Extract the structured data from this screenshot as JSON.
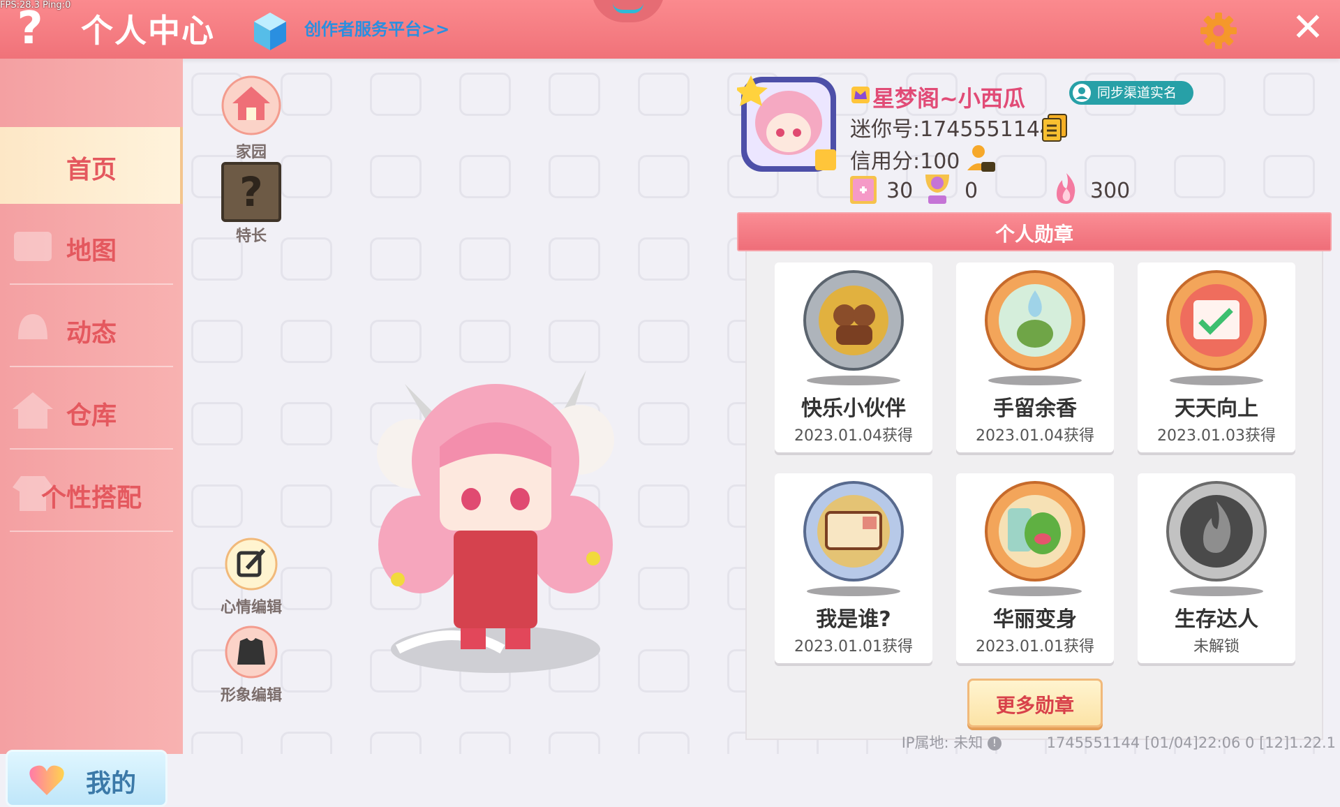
{
  "debug": {
    "fps": "FPS:28.3  Ping:0"
  },
  "header": {
    "help_icon": "question-mark-icon",
    "title": "个人中心",
    "creator_link": "创作者服务平台>>",
    "settings_icon": "gear-icon",
    "close_icon": "close-icon",
    "colors": {
      "bar": "#f07279",
      "link": "#2a8fe0"
    }
  },
  "sidebar": {
    "items": [
      {
        "label": "首页",
        "active": true
      },
      {
        "label": "地图",
        "active": false
      },
      {
        "label": "动态",
        "active": false
      },
      {
        "label": "仓库",
        "active": false
      },
      {
        "label": "个性搭配",
        "active": false
      }
    ],
    "mine_button": "我的"
  },
  "actions": {
    "home": "家园",
    "skill": "特长",
    "skill_icon_text": "?",
    "mood": "心情编辑",
    "appearance": "形象编辑"
  },
  "profile": {
    "nickname": "星梦阁~小西瓜",
    "sync_badge": "同步渠道实名",
    "mini_id": "迷你号:1745551144",
    "credit": "信用分:100",
    "stats": {
      "popularity": "30",
      "likes": "0",
      "heat": "300"
    }
  },
  "medals": {
    "title": "个人勋章",
    "items": [
      {
        "name": "快乐小伙伴",
        "date": "2023.01.04获得",
        "style": "silver"
      },
      {
        "name": "手留余香",
        "date": "2023.01.04获得",
        "style": "bronze"
      },
      {
        "name": "天天向上",
        "date": "2023.01.03获得",
        "style": "bronze"
      },
      {
        "name": "我是谁?",
        "date": "2023.01.01获得",
        "style": "silver"
      },
      {
        "name": "华丽变身",
        "date": "2023.01.01获得",
        "style": "bronze"
      },
      {
        "name": "生存达人",
        "date": "未解锁",
        "style": "locked"
      }
    ],
    "more_button": "更多勋章"
  },
  "footer": {
    "ip": "IP属地: 未知",
    "info": "1745551144  [01/04]22:06 0 [12]1.22.1"
  }
}
